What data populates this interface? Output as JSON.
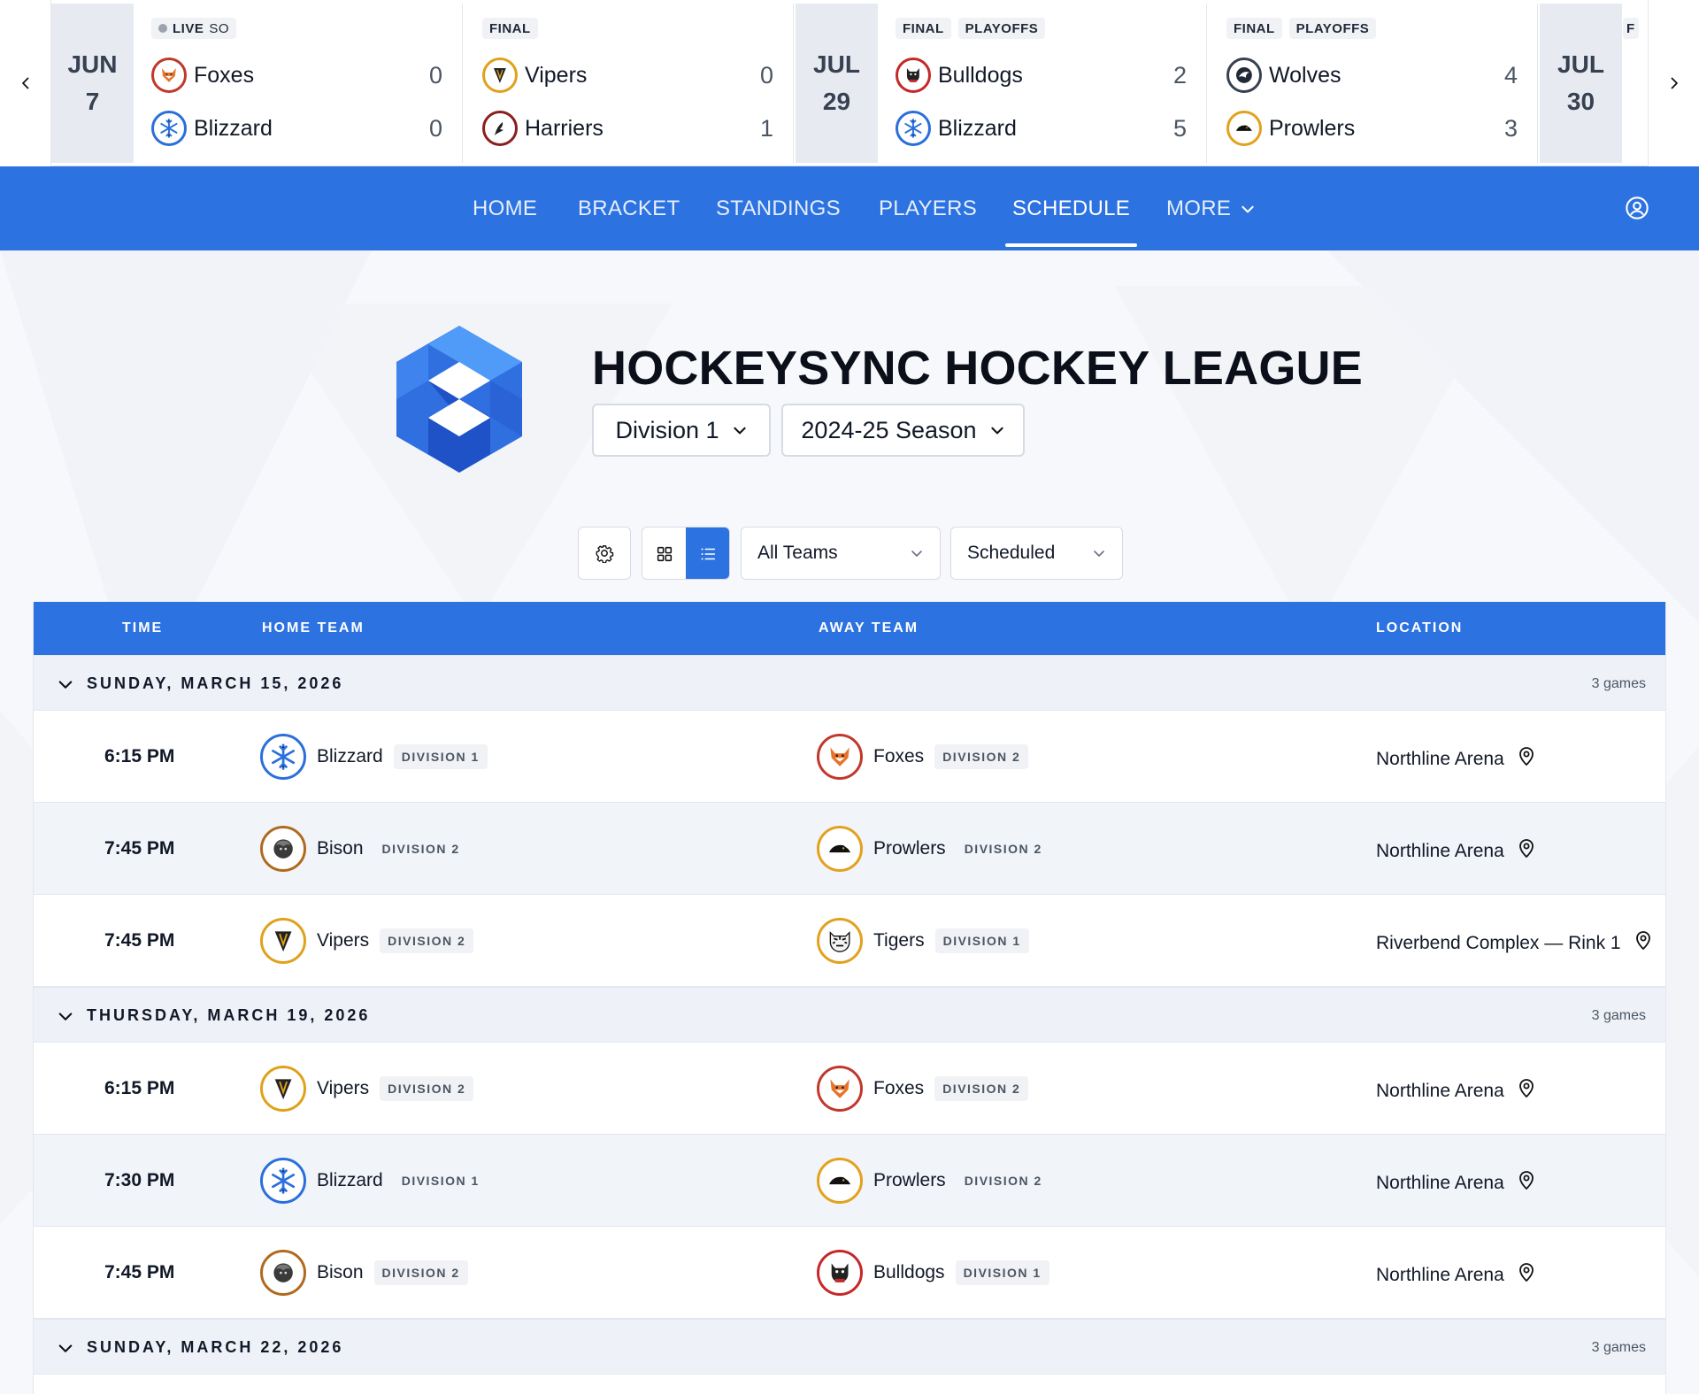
{
  "ticker": {
    "dates": [
      {
        "month": "JUN",
        "day": "7"
      },
      {
        "month": "JUL",
        "day": "29"
      },
      {
        "month": "JUL",
        "day": "30"
      }
    ],
    "games": [
      {
        "tags": [
          "LIVE SO"
        ],
        "live": true,
        "teams": [
          {
            "name": "Foxes",
            "score": "0",
            "logo": "foxes"
          },
          {
            "name": "Blizzard",
            "score": "0",
            "logo": "blizzard"
          }
        ]
      },
      {
        "tags": [
          "FINAL"
        ],
        "live": false,
        "teams": [
          {
            "name": "Vipers",
            "score": "0",
            "logo": "vipers"
          },
          {
            "name": "Harriers",
            "score": "1",
            "logo": "harriers"
          }
        ]
      },
      {
        "tags": [
          "FINAL",
          "PLAYOFFS"
        ],
        "live": false,
        "teams": [
          {
            "name": "Bulldogs",
            "score": "2",
            "logo": "bulldogs"
          },
          {
            "name": "Blizzard",
            "score": "5",
            "logo": "blizzard"
          }
        ]
      },
      {
        "tags": [
          "FINAL",
          "PLAYOFFS"
        ],
        "live": false,
        "teams": [
          {
            "name": "Wolves",
            "score": "4",
            "logo": "wolves"
          },
          {
            "name": "Prowlers",
            "score": "3",
            "logo": "prowlers"
          }
        ]
      }
    ],
    "live_label": "LIVE",
    "so_label": "SO",
    "peek_tag": "F"
  },
  "nav": {
    "items": [
      "HOME",
      "BRACKET",
      "STANDINGS",
      "PLAYERS",
      "SCHEDULE",
      "MORE"
    ],
    "active": "SCHEDULE"
  },
  "header": {
    "title": "HOCKEYSYNC HOCKEY LEAGUE",
    "division": "Division 1",
    "season": "2024-25 Season"
  },
  "filters": {
    "teams": "All Teams",
    "status": "Scheduled",
    "view": "list"
  },
  "table": {
    "columns": [
      "TIME",
      "HOME TEAM",
      "AWAY TEAM",
      "LOCATION"
    ],
    "days": [
      {
        "label": "SUNDAY, MARCH 15, 2026",
        "count": "3 games",
        "games": [
          {
            "time": "6:15 PM",
            "home": "Blizzard",
            "home_div": "DIVISION 1",
            "home_logo": "blizzard",
            "away": "Foxes",
            "away_div": "DIVISION 2",
            "away_logo": "foxes",
            "location": "Northline Arena"
          },
          {
            "time": "7:45 PM",
            "home": "Bison",
            "home_div": "DIVISION 2",
            "home_logo": "bison",
            "away": "Prowlers",
            "away_div": "DIVISION 2",
            "away_logo": "prowlers",
            "location": "Northline Arena"
          },
          {
            "time": "7:45 PM",
            "home": "Vipers",
            "home_div": "DIVISION 2",
            "home_logo": "vipers",
            "away": "Tigers",
            "away_div": "DIVISION 1",
            "away_logo": "tigers",
            "location": "Riverbend Complex — Rink 1"
          }
        ]
      },
      {
        "label": "THURSDAY, MARCH 19, 2026",
        "count": "3 games",
        "games": [
          {
            "time": "6:15 PM",
            "home": "Vipers",
            "home_div": "DIVISION 2",
            "home_logo": "vipers",
            "away": "Foxes",
            "away_div": "DIVISION 2",
            "away_logo": "foxes",
            "location": "Northline Arena"
          },
          {
            "time": "7:30 PM",
            "home": "Blizzard",
            "home_div": "DIVISION 1",
            "home_logo": "blizzard",
            "away": "Prowlers",
            "away_div": "DIVISION 2",
            "away_logo": "prowlers",
            "location": "Northline Arena"
          },
          {
            "time": "7:45 PM",
            "home": "Bison",
            "home_div": "DIVISION 2",
            "home_logo": "bison",
            "away": "Bulldogs",
            "away_div": "DIVISION 1",
            "away_logo": "bulldogs",
            "location": "Northline Arena"
          }
        ]
      },
      {
        "label": "SUNDAY, MARCH 22, 2026",
        "count": "3 games",
        "games": []
      }
    ]
  },
  "colors": {
    "brand_blue": "#2c72e0",
    "row_alt": "#f1f4f9",
    "day_row": "#eef2f8"
  },
  "icons": {
    "prev": "chevron-left-icon",
    "next": "chevron-right-icon",
    "user": "user-circle-icon",
    "settings": "gear-icon",
    "grid": "grid-view-icon",
    "list": "list-view-icon",
    "location": "map-pin-icon"
  }
}
